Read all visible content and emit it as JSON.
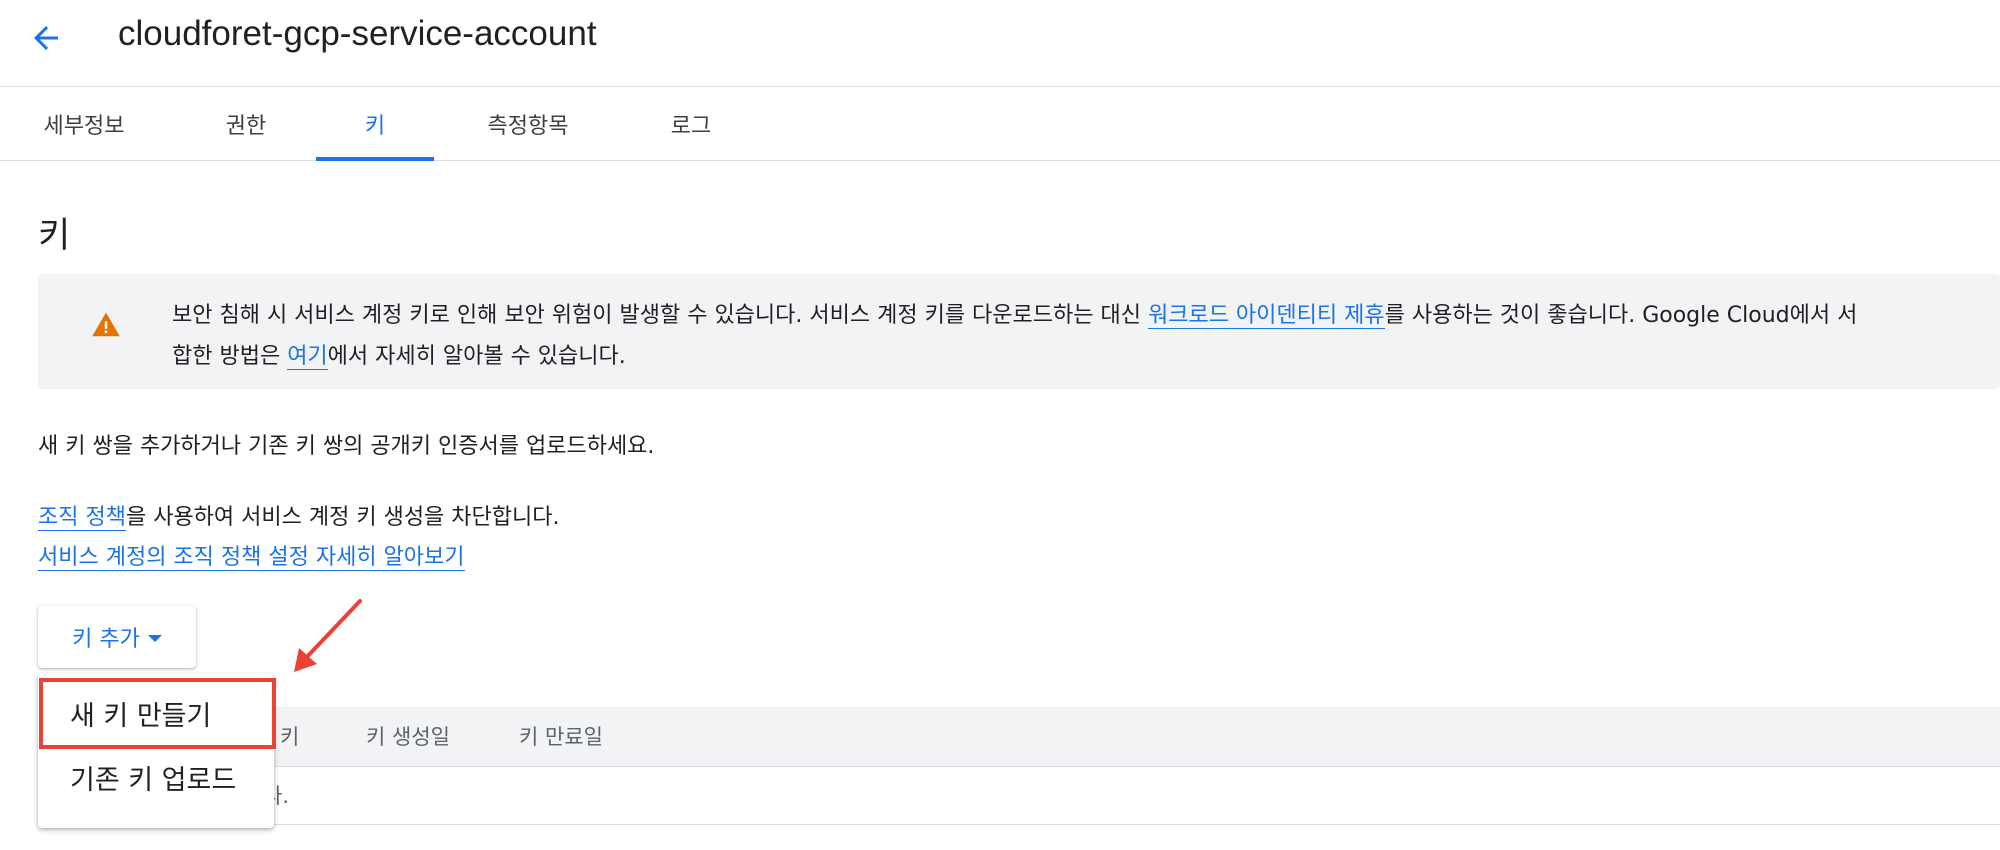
{
  "header": {
    "title": "cloudforet-gcp-service-account"
  },
  "tabs": [
    {
      "label": "세부정보",
      "active": false
    },
    {
      "label": "권한",
      "active": false
    },
    {
      "label": "키",
      "active": true
    },
    {
      "label": "측정항목",
      "active": false
    },
    {
      "label": "로그",
      "active": false
    }
  ],
  "main": {
    "section_title": "키",
    "warning": {
      "line1_a": "보안 침해 시 서비스 계정 키로 인해 보안 위험이 발생할 수 있습니다. 서비스 계정 키를 다운로드하는 대신 ",
      "line1_link": "워크로드 아이덴티티 제휴",
      "line1_b": "를 사용하는 것이 좋습니다. Google Cloud에서 서",
      "line2_a": "합한 방법은 ",
      "line2_link": "여기",
      "line2_b": "에서 자세히 알아볼 수 있습니다."
    },
    "intro_text": "새 키 쌍을 추가하거나 기존 키 쌍의 공개키 인증서를 업로드하세요.",
    "policy": {
      "link": "조직 정책",
      "text": "을 사용하여 서비스 계정 키 생성을 차단합니다.",
      "learn_more_link": "서비스 계정의 조직 정책 설정 자세히 알아보기"
    },
    "add_key_button": "키 추가",
    "dropdown_menu": [
      "새 키 만들기",
      "기존 키 업로드"
    ],
    "table": {
      "headers": [
        "키",
        "키 생성일",
        "키 만료일"
      ],
      "empty_fragment": "다."
    }
  },
  "colors": {
    "accent": "#1a73e8",
    "warning_icon": "#e37400",
    "annotation": "#ea4335",
    "banner_bg": "#f1f3f4"
  },
  "icons": {
    "back": "arrow-back-icon",
    "warning": "warning-triangle-icon",
    "dropdown": "caret-down-icon",
    "annotation": "red-arrow-annotation"
  }
}
